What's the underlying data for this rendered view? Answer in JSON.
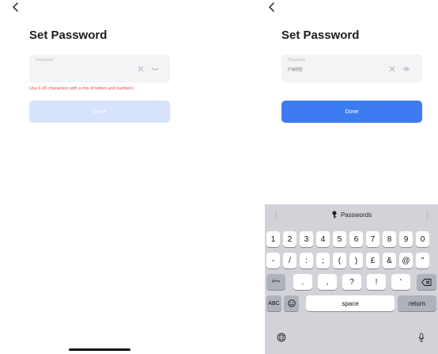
{
  "left_screen": {
    "title": "Set Password",
    "field_label": "Password",
    "hint": "Use 6-20 characters with a mix of letters and numbers",
    "done_label": "Done"
  },
  "right_screen": {
    "title": "Set Password",
    "field_label": "Password",
    "field_value": "l*#ff0",
    "done_label": "Done"
  },
  "keyboard": {
    "suggestion": "Passwords",
    "row1": [
      "1",
      "2",
      "3",
      "4",
      "5",
      "6",
      "7",
      "8",
      "9",
      "0"
    ],
    "row2": [
      "-",
      "/",
      ":",
      ";",
      "(",
      ")",
      "£",
      "&",
      "@",
      "\""
    ],
    "row3_mode": "#+=",
    "row3": [
      ".",
      ",",
      "?",
      "!",
      "'"
    ],
    "abc": "ABC",
    "space": "space",
    "return": "return"
  },
  "colors": {
    "primary": "#3d7cf0",
    "primary_disabled": "#d6e3fb",
    "error": "#e8474a",
    "keyboard_bg": "#d1d3d9"
  }
}
